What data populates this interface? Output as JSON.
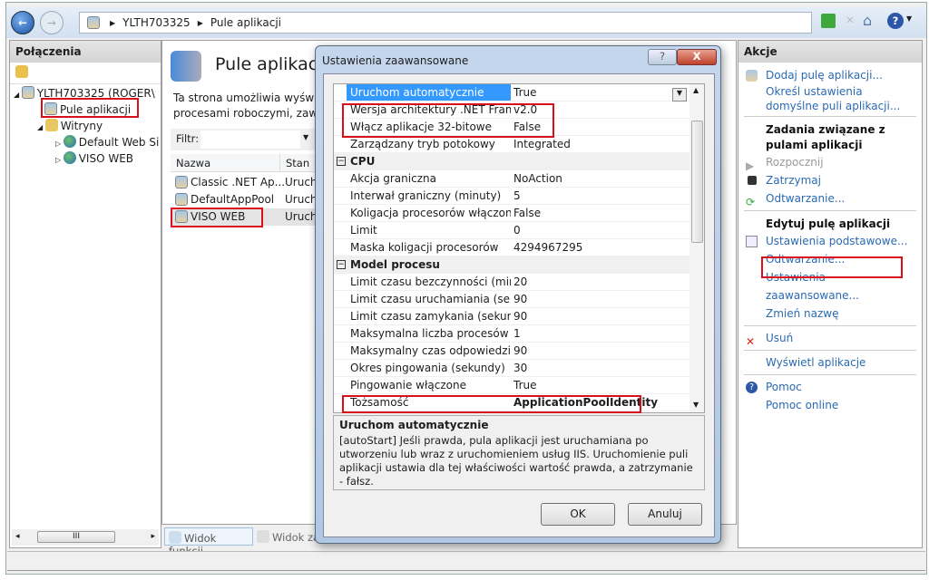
{
  "nav": {
    "breadcrumb": [
      "YLTH703325",
      "Pule aplikacji"
    ]
  },
  "left": {
    "title": "Połączenia",
    "tree": [
      {
        "label": "YLTH703325 (ROGER\\",
        "level": 0
      },
      {
        "label": "Pule aplikacji",
        "level": 1
      },
      {
        "label": "Witryny",
        "level": 1
      },
      {
        "label": "Default Web Si",
        "level": 2
      },
      {
        "label": "VISO WEB",
        "level": 2
      }
    ],
    "scroll_glyph": "III"
  },
  "main": {
    "title": "Pule aplikacji",
    "desc1": "Ta strona umożliwia wyświetl",
    "desc2": "procesami roboczymi, zawiera",
    "filter_label": "Filtr:",
    "columns": [
      "Nazwa",
      "Stan"
    ],
    "rows": [
      {
        "name": "Classic .NET Ap...",
        "state": "Uruch"
      },
      {
        "name": "DefaultAppPool",
        "state": "Uruch"
      },
      {
        "name": "VISO WEB",
        "state": "Uruch"
      }
    ],
    "tab_features": "Widok funkcji",
    "tab_content": "Widok za"
  },
  "dialog": {
    "title": "Ustawienia zaawansowane",
    "help": "?",
    "close": "X",
    "rows": [
      {
        "label": "Uruchom automatycznie",
        "value": "True",
        "selected": true
      },
      {
        "label": "Wersja architektury .NET Framework",
        "value": "v2.0"
      },
      {
        "label": "Włącz aplikacje 32-bitowe",
        "value": "False"
      },
      {
        "label": "Zarządzany tryb potokowy",
        "value": "Integrated"
      },
      {
        "label": "CPU",
        "category": true
      },
      {
        "label": "Akcja graniczna",
        "value": "NoAction"
      },
      {
        "label": "Interwał graniczny (minuty)",
        "value": "5"
      },
      {
        "label": "Koligacja procesorów włączona",
        "value": "False"
      },
      {
        "label": "Limit",
        "value": "0"
      },
      {
        "label": "Maska koligacji procesorów",
        "value": "4294967295"
      },
      {
        "label": "Model procesu",
        "category": true
      },
      {
        "label": "Limit czasu bezczynności (minuty)",
        "value": "20"
      },
      {
        "label": "Limit czasu uruchamiania (sekundy)",
        "value": "90"
      },
      {
        "label": "Limit czasu zamykania (sekundy)",
        "value": "90"
      },
      {
        "label": "Maksymalna liczba procesów roboczych",
        "value": "1"
      },
      {
        "label": "Maksymalny czas odpowiedzi polecenia ping",
        "value": "90"
      },
      {
        "label": "Okres pingowania (sekundy)",
        "value": "30"
      },
      {
        "label": "Pingowanie włączone",
        "value": "True"
      },
      {
        "label": "Tożsamość",
        "value": "ApplicationPoolIdentity",
        "bold": true
      }
    ],
    "desc_title": "Uruchom automatycznie",
    "desc_text": "[autoStart] Jeśli prawda, pula aplikacji jest uruchamiana po utworzeniu lub wraz z uruchomieniem usług IIS. Uruchomienie puli aplikacji ustawia dla tej właściwości wartość prawda, a zatrzymanie - fałsz.",
    "ok": "OK",
    "cancel": "Anuluj"
  },
  "actions": {
    "title": "Akcje",
    "items": [
      {
        "type": "link",
        "label": "Dodaj pulę aplikacji...",
        "icon": "pool-add-icon"
      },
      {
        "type": "link",
        "label": "Określ ustawienia domyślne puli aplikacji..."
      },
      {
        "type": "sep"
      },
      {
        "type": "head",
        "label": "Zadania związane z pulami aplikacji"
      },
      {
        "type": "link",
        "label": "Rozpocznij",
        "icon": "play-icon",
        "disabled": true
      },
      {
        "type": "link",
        "label": "Zatrzymaj",
        "icon": "stop-icon"
      },
      {
        "type": "link",
        "label": "Odtwarzanie...",
        "icon": "recycle-icon"
      },
      {
        "type": "sep"
      },
      {
        "type": "head",
        "label": "Edytuj pulę aplikacji"
      },
      {
        "type": "link",
        "label": "Ustawienia podstawowe...",
        "icon": "settings-icon"
      },
      {
        "type": "link",
        "label": "Odtwarzanie..."
      },
      {
        "type": "link",
        "label": "Ustawienia zaawansowane...",
        "highlight": true
      },
      {
        "type": "link",
        "label": "Zmień nazwę"
      },
      {
        "type": "sep"
      },
      {
        "type": "link",
        "label": "Usuń",
        "icon": "delete-icon"
      },
      {
        "type": "sep"
      },
      {
        "type": "link",
        "label": "Wyświetl aplikacje"
      },
      {
        "type": "sep"
      },
      {
        "type": "link",
        "label": "Pomoc",
        "icon": "help-icon"
      },
      {
        "type": "link",
        "label": "Pomoc online"
      }
    ]
  },
  "colors": {
    "highlight": "#d9101c",
    "link": "#2a6ab4",
    "selection": "#3399ff"
  }
}
